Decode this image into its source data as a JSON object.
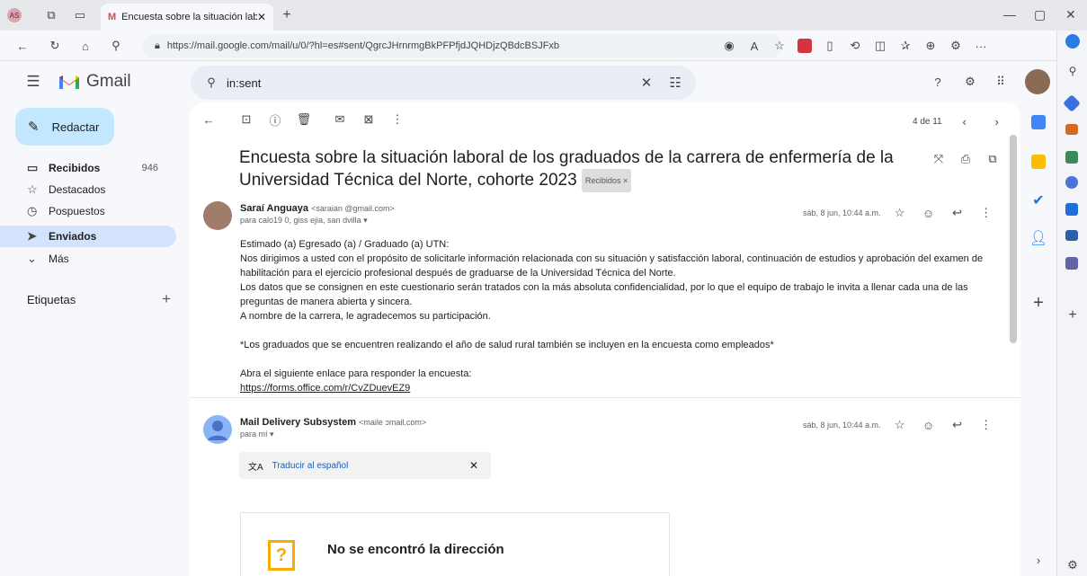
{
  "browser": {
    "profile": "AS",
    "tab_title": "Encuesta sobre la situación labor",
    "url": "https://mail.google.com/mail/u/0/?hl=es#sent/QgrcJHrnrmgBkPFPfjdJQHDjzQBdcBSJFxb"
  },
  "gmail": {
    "logo_text": "Gmail",
    "search_value": "in:sent",
    "compose_label": "Redactar",
    "nav": [
      {
        "label": "Recibidos",
        "count": "946"
      },
      {
        "label": "Destacados",
        "count": ""
      },
      {
        "label": "Pospuestos",
        "count": ""
      },
      {
        "label": "Enviados",
        "count": ""
      },
      {
        "label": "Más",
        "count": ""
      }
    ],
    "labels_heading": "Etiquetas"
  },
  "toolbar": {
    "pagination": "4 de 11"
  },
  "thread": {
    "subject": "Encuesta sobre la situación laboral de los graduados de la carrera de enfermería de la Universidad Técnica del Norte, cohorte 2023",
    "label_chip": "Recibidos ×",
    "messages": [
      {
        "sender": "Saraí Anguaya",
        "sender_email": "<saraian          @gmail.com>",
        "recipients": "para calo19      0, giss     ejia, san          dvilla ▾",
        "date": "sáb, 8 jun, 10:44 a.m.",
        "body": [
          "Estimado (a) Egresado (a) / Graduado (a) UTN:",
          "Nos dirigimos a usted con el propósito de solicitarle información relacionada con su situación y satisfacción laboral, continuación de estudios y aprobación del examen de habilitación para el ejercicio profesional después de graduarse de la Universidad Técnica del Norte.",
          "Los datos que se consignen en este cuestionario serán tratados con la más absoluta confidencialidad, por lo que el equipo de trabajo le invita a llenar cada una de las preguntas de manera abierta y sincera.",
          "A nombre de la carrera, le agradecemos su participación.",
          "",
          "*Los graduados que se encuentren realizando el año de salud rural también se incluyen en la encuesta como empleados*",
          "",
          "Abra el siguiente enlace para responder la encuesta:"
        ],
        "link": "https://forms.office.com/r/CvZDuevEZ9"
      },
      {
        "sender": "Mail Delivery Subsystem",
        "sender_email": "<maile                    ɔmail.com>",
        "recipients": "para mí ▾",
        "date": "sáb, 8 jun, 10:44 a.m.",
        "translate_label": "Traducir al español",
        "bounce_title": "No se encontró la dirección"
      }
    ]
  },
  "colors": {
    "compose_bg": "#c2e7ff",
    "active_nav_bg": "#d3e3fd",
    "gmail_red": "#ea4335",
    "link": "#1a0dab"
  }
}
